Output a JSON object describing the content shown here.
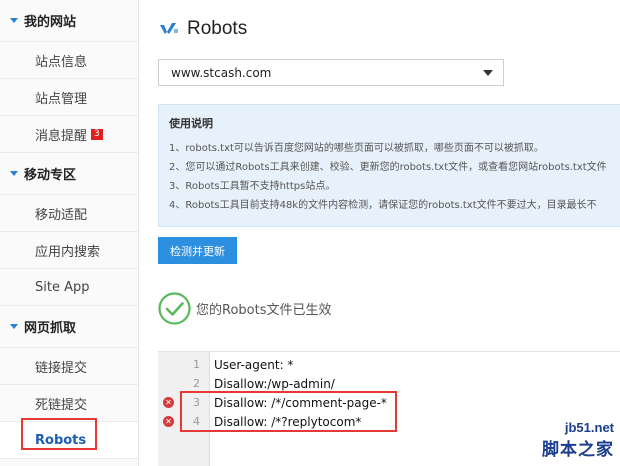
{
  "sidebar": {
    "sections": [
      {
        "title": "我的网站",
        "items": [
          {
            "label": "站点信息"
          },
          {
            "label": "站点管理"
          },
          {
            "label": "消息提醒",
            "badge": "3"
          }
        ]
      },
      {
        "title": "移动专区",
        "items": [
          {
            "label": "移动适配"
          },
          {
            "label": "应用内搜索"
          },
          {
            "label": "Site App"
          }
        ]
      },
      {
        "title": "网页抓取",
        "items": [
          {
            "label": "链接提交"
          },
          {
            "label": "死链提交"
          },
          {
            "label": "Robots"
          }
        ]
      }
    ]
  },
  "header": {
    "title": "Robots",
    "icon": "robots-logo-icon"
  },
  "site_select": {
    "value": "www.stcash.com"
  },
  "help": {
    "title": "使用说明",
    "lines": [
      "1、robots.txt可以告诉百度您网站的哪些页面可以被抓取，哪些页面不可以被抓取。",
      "2、您可以通过Robots工具来创建、校验、更新您的robots.txt文件，或查看您网站robots.txt文件",
      "3、Robots工具暂不支持https站点。",
      "4、Robots工具目前支持48k的文件内容检测，请保证您的robots.txt文件不要过大，目录最长不"
    ]
  },
  "action": {
    "button_label": "检测并更新"
  },
  "status": {
    "text": "您的Robots文件已生效"
  },
  "editor": {
    "lines": [
      {
        "num": "1",
        "text": "User-agent: *",
        "error": false
      },
      {
        "num": "2",
        "text": "Disallow:/wp-admin/",
        "error": false
      },
      {
        "num": "3",
        "text": "Disallow:   /*/comment-page-*",
        "error": true
      },
      {
        "num": "4",
        "text": "Disallow:   /*?replytocom*",
        "error": true
      }
    ]
  },
  "watermark": {
    "line1": "jb51.net",
    "line2": "脚本之家"
  },
  "colors": {
    "accent": "#2d8fe0",
    "highlight": "#e53935",
    "success": "#5cb85c",
    "error": "#d43b3b"
  }
}
